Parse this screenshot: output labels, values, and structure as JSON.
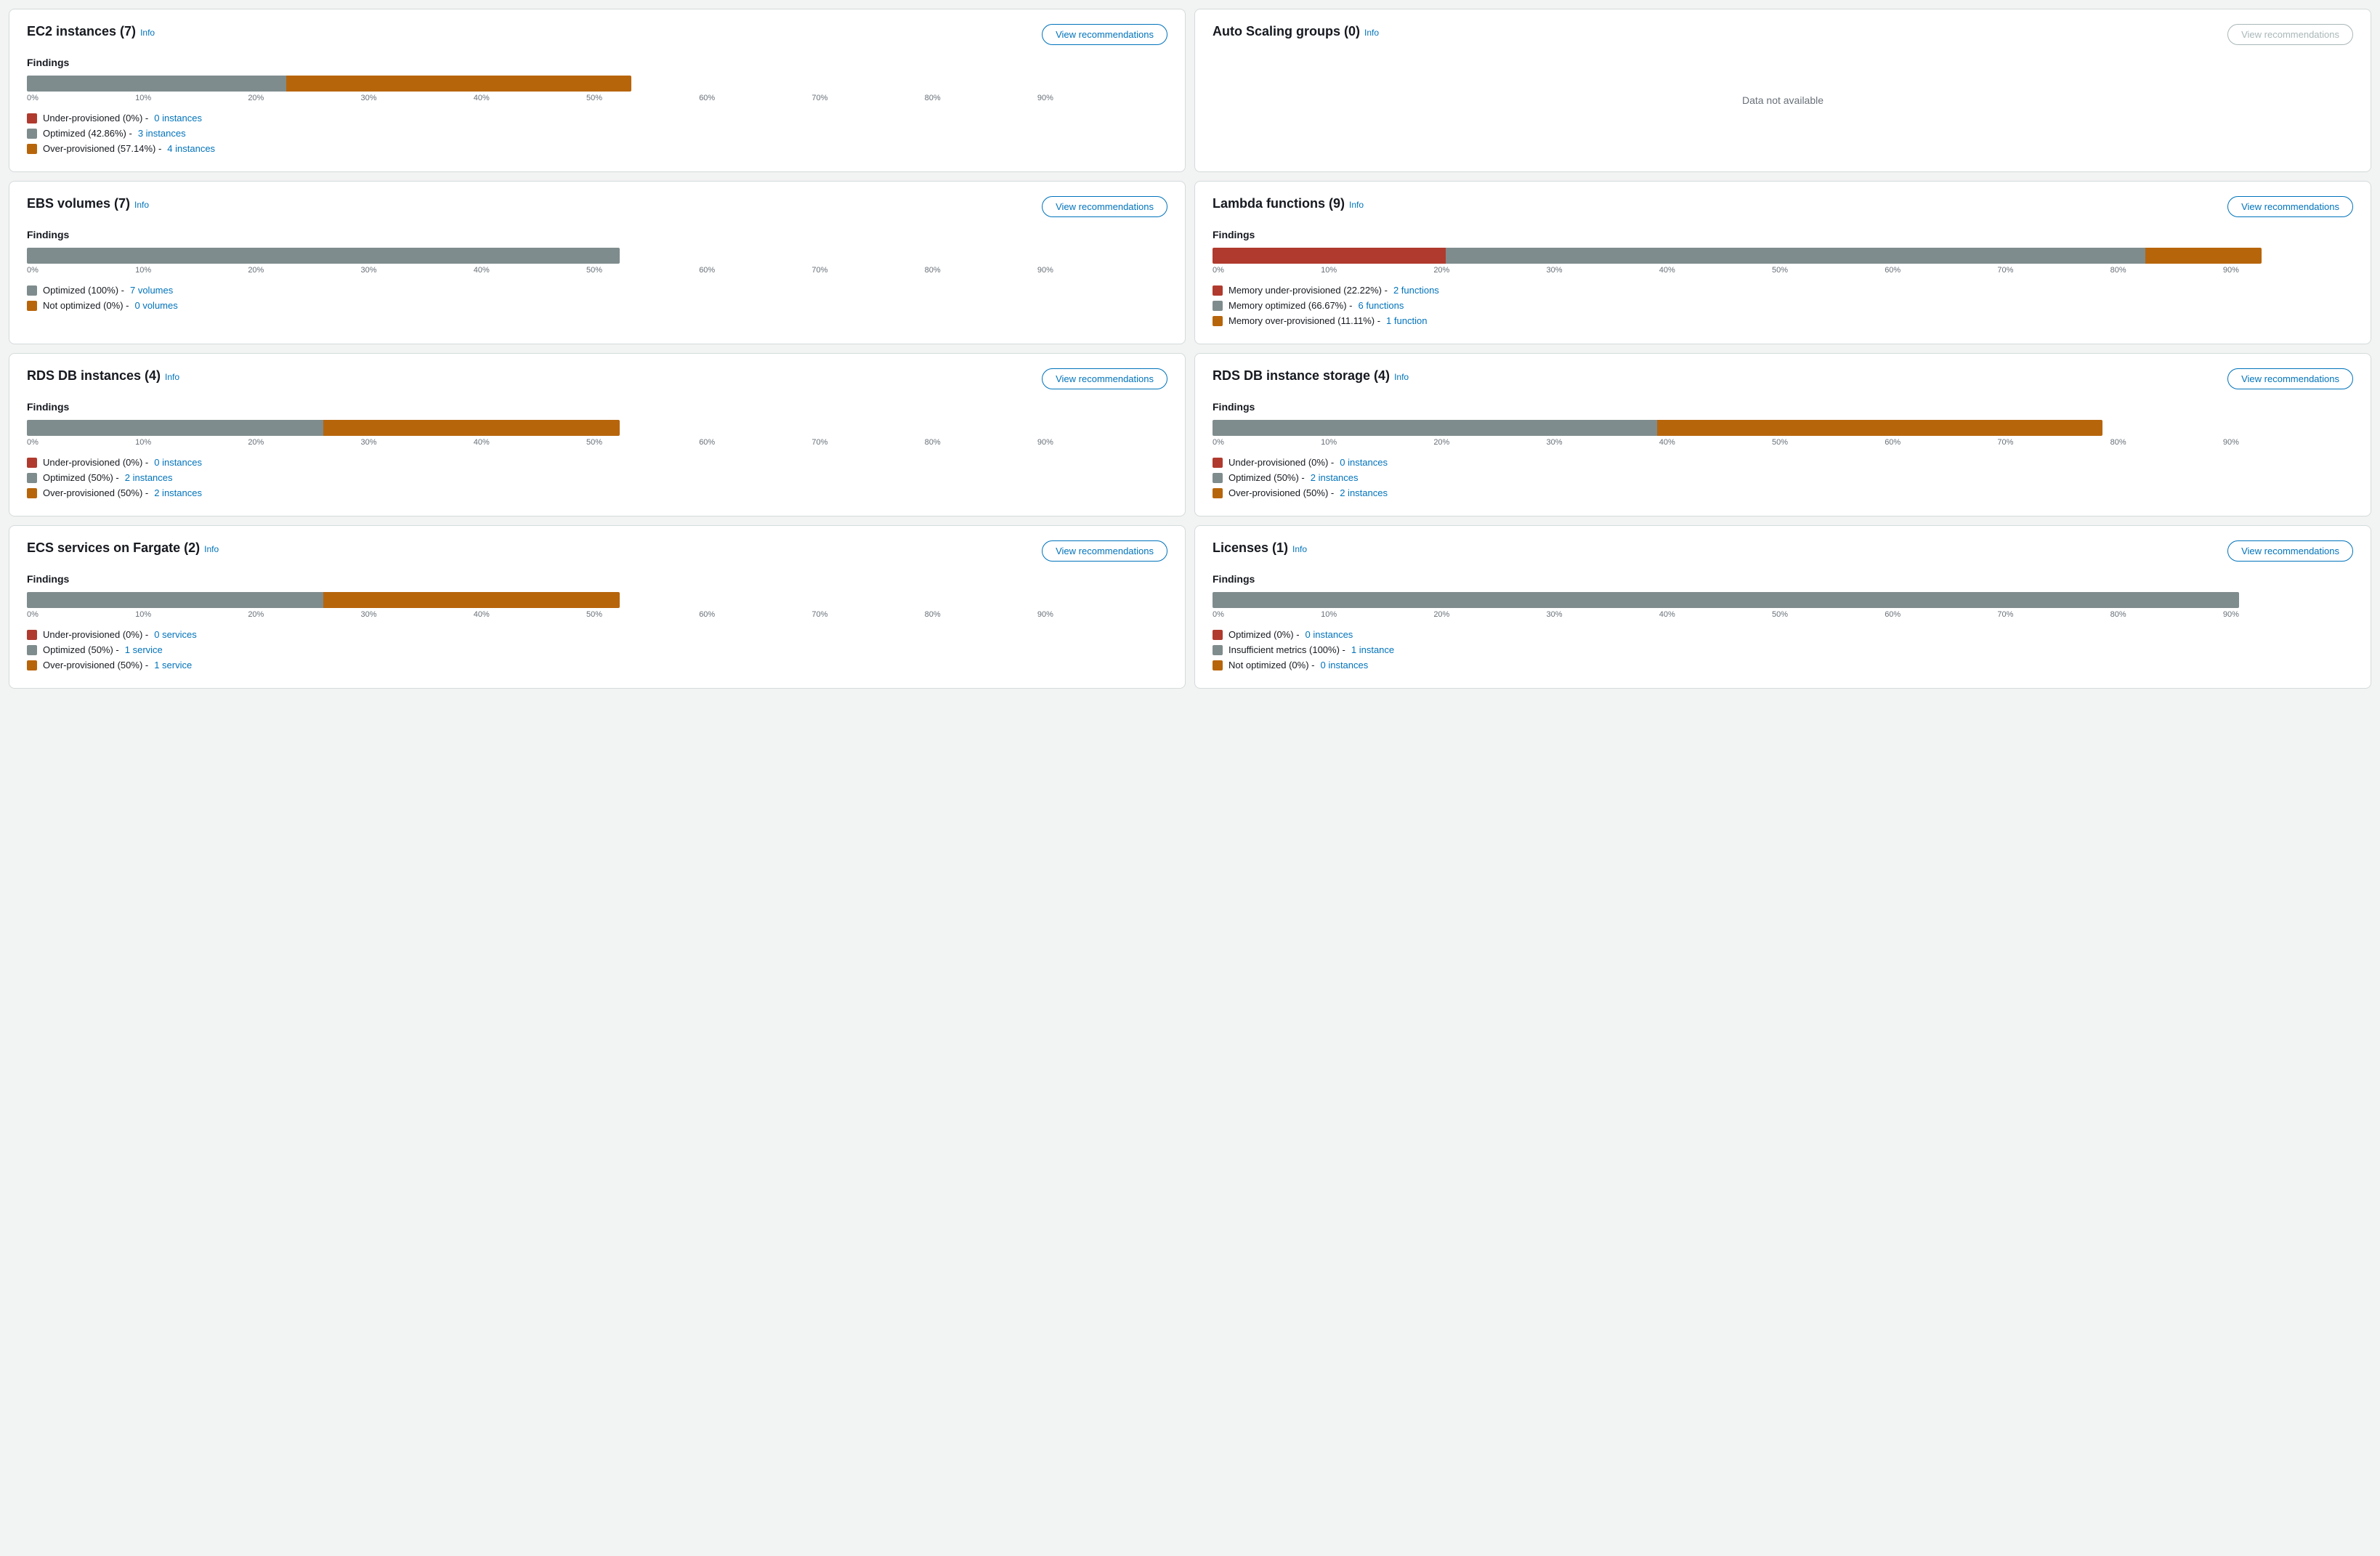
{
  "cards": [
    {
      "id": "ec2",
      "title": "EC2 instances",
      "count": "(7)",
      "info": "Info",
      "btnLabel": "View recommendations",
      "btnDisabled": false,
      "hasData": true,
      "barSegments": [
        {
          "color": "color-under",
          "pct": 0
        },
        {
          "color": "color-optimized",
          "pct": 42.86
        },
        {
          "color": "color-over",
          "pct": 57.14
        }
      ],
      "barTotalWidthPct": 53,
      "barLabels": [
        "0%",
        "10%",
        "20%",
        "30%",
        "40%",
        "50%",
        "60%",
        "70%",
        "80%",
        "90%"
      ],
      "legend": [
        {
          "color": "color-under",
          "label": "Under-provisioned (0%) - ",
          "linkText": "0 instances",
          "href": "#"
        },
        {
          "color": "color-optimized",
          "label": "Optimized (42.86%) - ",
          "linkText": "3 instances",
          "href": "#"
        },
        {
          "color": "color-over",
          "label": "Over-provisioned (57.14%) - ",
          "linkText": "4 instances",
          "href": "#"
        }
      ]
    },
    {
      "id": "asg",
      "title": "Auto Scaling groups",
      "count": "(0)",
      "info": "Info",
      "btnLabel": "View recommendations",
      "btnDisabled": true,
      "hasData": false,
      "dataNotAvailableText": "Data not available",
      "barSegments": [],
      "barTotalWidthPct": 0,
      "barLabels": [],
      "legend": []
    },
    {
      "id": "ebs",
      "title": "EBS volumes",
      "count": "(7)",
      "info": "Info",
      "btnLabel": "View recommendations",
      "btnDisabled": false,
      "hasData": true,
      "barSegments": [
        {
          "color": "color-optimized",
          "pct": 100
        },
        {
          "color": "color-not-optimized",
          "pct": 0
        }
      ],
      "barTotalWidthPct": 52,
      "barLabels": [
        "0%",
        "10%",
        "20%",
        "30%",
        "40%",
        "50%",
        "60%",
        "70%",
        "80%",
        "90%"
      ],
      "legend": [
        {
          "color": "color-optimized",
          "label": "Optimized (100%) - ",
          "linkText": "7 volumes",
          "href": "#"
        },
        {
          "color": "color-not-optimized",
          "label": "Not optimized (0%) - ",
          "linkText": "0 volumes",
          "href": "#"
        }
      ]
    },
    {
      "id": "lambda",
      "title": "Lambda functions",
      "count": "(9)",
      "info": "Info",
      "btnLabel": "View recommendations",
      "btnDisabled": false,
      "hasData": true,
      "barSegments": [
        {
          "color": "color-memory-under",
          "pct": 22.22
        },
        {
          "color": "color-memory-optimized",
          "pct": 66.67
        },
        {
          "color": "color-memory-over",
          "pct": 11.11
        }
      ],
      "barTotalWidthPct": 92,
      "barLabels": [
        "0%",
        "10%",
        "20%",
        "30%",
        "40%",
        "50%",
        "60%",
        "70%",
        "80%",
        "90%"
      ],
      "legend": [
        {
          "color": "color-memory-under",
          "label": "Memory under-provisioned (22.22%) - ",
          "linkText": "2 functions",
          "href": "#"
        },
        {
          "color": "color-memory-optimized",
          "label": "Memory optimized (66.67%) - ",
          "linkText": "6 functions",
          "href": "#"
        },
        {
          "color": "color-memory-over",
          "label": "Memory over-provisioned (11.11%) - ",
          "linkText": "1 function",
          "href": "#"
        }
      ]
    },
    {
      "id": "rds",
      "title": "RDS DB instances",
      "count": "(4)",
      "info": "Info",
      "btnLabel": "View recommendations",
      "btnDisabled": false,
      "hasData": true,
      "barSegments": [
        {
          "color": "color-under",
          "pct": 0
        },
        {
          "color": "color-optimized",
          "pct": 50
        },
        {
          "color": "color-over",
          "pct": 50
        }
      ],
      "barTotalWidthPct": 52,
      "barLabels": [
        "0%",
        "10%",
        "20%",
        "30%",
        "40%",
        "50%",
        "60%",
        "70%",
        "80%",
        "90%"
      ],
      "legend": [
        {
          "color": "color-under",
          "label": "Under-provisioned (0%) - ",
          "linkText": "0 instances",
          "href": "#"
        },
        {
          "color": "color-optimized",
          "label": "Optimized (50%) - ",
          "linkText": "2 instances",
          "href": "#"
        },
        {
          "color": "color-over",
          "label": "Over-provisioned (50%) - ",
          "linkText": "2 instances",
          "href": "#"
        }
      ]
    },
    {
      "id": "rds-storage",
      "title": "RDS DB instance storage",
      "count": "(4)",
      "info": "Info",
      "btnLabel": "View recommendations",
      "btnDisabled": false,
      "hasData": true,
      "barSegments": [
        {
          "color": "color-under",
          "pct": 0
        },
        {
          "color": "color-optimized",
          "pct": 50
        },
        {
          "color": "color-over",
          "pct": 50
        }
      ],
      "barTotalWidthPct": 78,
      "barLabels": [
        "0%",
        "10%",
        "20%",
        "30%",
        "40%",
        "50%",
        "60%",
        "70%",
        "80%",
        "90%"
      ],
      "legend": [
        {
          "color": "color-under",
          "label": "Under-provisioned (0%) - ",
          "linkText": "0 instances",
          "href": "#"
        },
        {
          "color": "color-optimized",
          "label": "Optimized (50%) - ",
          "linkText": "2 instances",
          "href": "#"
        },
        {
          "color": "color-over",
          "label": "Over-provisioned (50%) - ",
          "linkText": "2 instances",
          "href": "#"
        }
      ]
    },
    {
      "id": "ecs",
      "title": "ECS services on Fargate",
      "count": "(2)",
      "info": "Info",
      "btnLabel": "View recommendations",
      "btnDisabled": false,
      "hasData": true,
      "barSegments": [
        {
          "color": "color-under",
          "pct": 0
        },
        {
          "color": "color-optimized",
          "pct": 50
        },
        {
          "color": "color-over",
          "pct": 50
        }
      ],
      "barTotalWidthPct": 52,
      "barLabels": [
        "0%",
        "10%",
        "20%",
        "30%",
        "40%",
        "50%",
        "60%",
        "70%",
        "80%",
        "90%"
      ],
      "legend": [
        {
          "color": "color-under",
          "label": "Under-provisioned (0%) - ",
          "linkText": "0 services",
          "href": "#"
        },
        {
          "color": "color-optimized",
          "label": "Optimized (50%) - ",
          "linkText": "1 service",
          "href": "#"
        },
        {
          "color": "color-over",
          "label": "Over-provisioned (50%) - ",
          "linkText": "1 service",
          "href": "#"
        }
      ]
    },
    {
      "id": "licenses",
      "title": "Licenses",
      "count": "(1)",
      "info": "Info",
      "btnLabel": "View recommendations",
      "btnDisabled": false,
      "hasData": true,
      "barSegments": [
        {
          "color": "color-under",
          "pct": 0
        },
        {
          "color": "color-insufficient",
          "pct": 100
        },
        {
          "color": "color-not-optimized",
          "pct": 0
        }
      ],
      "barTotalWidthPct": 90,
      "barLabels": [
        "0%",
        "10%",
        "20%",
        "30%",
        "40%",
        "50%",
        "60%",
        "70%",
        "80%",
        "90%"
      ],
      "legend": [
        {
          "color": "color-under",
          "label": "Optimized (0%) - ",
          "linkText": "0 instances",
          "href": "#"
        },
        {
          "color": "color-insufficient",
          "label": "Insufficient metrics (100%) - ",
          "linkText": "1 instance",
          "href": "#"
        },
        {
          "color": "color-not-optimized",
          "label": "Not optimized (0%) - ",
          "linkText": "0 instances",
          "href": "#"
        }
      ]
    }
  ]
}
